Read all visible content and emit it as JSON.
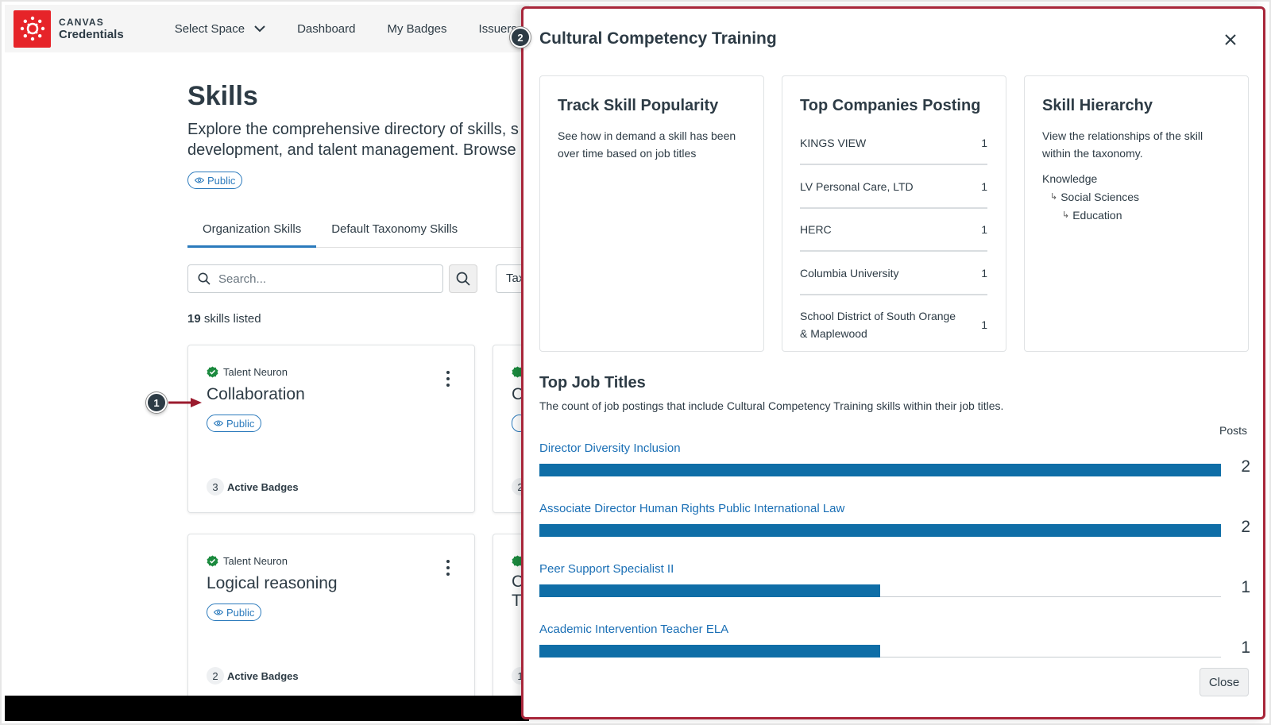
{
  "brand": {
    "top": "CANVAS",
    "bottom": "Credentials"
  },
  "nav": {
    "select_space": "Select Space",
    "dashboard": "Dashboard",
    "my_badges": "My Badges",
    "issuers": "Issuers"
  },
  "page": {
    "title": "Skills",
    "desc_line1": "Explore the comprehensive directory of skills, s",
    "desc_line2": "development, and talent management. Browse",
    "visibility": "Public"
  },
  "tabs": [
    "Organization Skills",
    "Default Taxonomy Skills"
  ],
  "search": {
    "placeholder": "Search..."
  },
  "taxonomy_select": "Tax",
  "count": {
    "number": "19",
    "label": "skills listed"
  },
  "cards": [
    {
      "issuer": "Talent Neuron",
      "name": "Collaboration",
      "visibility": "Public",
      "badge_count": "3",
      "badge_label": "Active Badges"
    },
    {
      "issuer": "Talent Neuron",
      "name": "Logical reasoning",
      "visibility": "Public",
      "badge_count": "2",
      "badge_label": "Active Badges"
    }
  ],
  "peek_cards": [
    {
      "name": "C",
      "badge_count": "2"
    },
    {
      "name_line1": "C",
      "name_line2": "Tr",
      "badge_count": "1"
    }
  ],
  "callouts": [
    "1",
    "2"
  ],
  "tray": {
    "title": "Cultural Competency Training",
    "popularity": {
      "title": "Track Skill Popularity",
      "desc": "See how in demand a skill has been over time based on job titles"
    },
    "companies": {
      "title": "Top Companies Posting",
      "rows": [
        {
          "name": "KINGS VIEW",
          "count": "1"
        },
        {
          "name": "LV Personal Care, LTD",
          "count": "1"
        },
        {
          "name": "HERC",
          "count": "1"
        },
        {
          "name": "Columbia University",
          "count": "1"
        },
        {
          "name": "School District of South Orange & Maplewood",
          "count": "1"
        }
      ]
    },
    "hierarchy": {
      "title": "Skill Hierarchy",
      "desc": "View the relationships of the skill within the taxonomy.",
      "levels": [
        "Knowledge",
        "Social Sciences",
        "Education"
      ]
    },
    "job_titles": {
      "title": "Top Job Titles",
      "desc": "The count of job postings that include Cultural Competency Training skills within their job titles.",
      "posts_label": "Posts",
      "max": 2,
      "rows": [
        {
          "title": "Director Diversity Inclusion",
          "count": 2
        },
        {
          "title": "Associate Director Human Rights Public International Law",
          "count": 2
        },
        {
          "title": "Peer Support Specialist II",
          "count": 1
        },
        {
          "title": "Academic Intervention Teacher ELA",
          "count": 1
        }
      ]
    },
    "close_label": "Close"
  },
  "colors": {
    "brand_red": "#e62429",
    "accent_blue": "#2b7abc",
    "bar_blue": "#0f6ea7",
    "tray_border": "#a8263a",
    "verified_green": "#1b8a3e"
  }
}
